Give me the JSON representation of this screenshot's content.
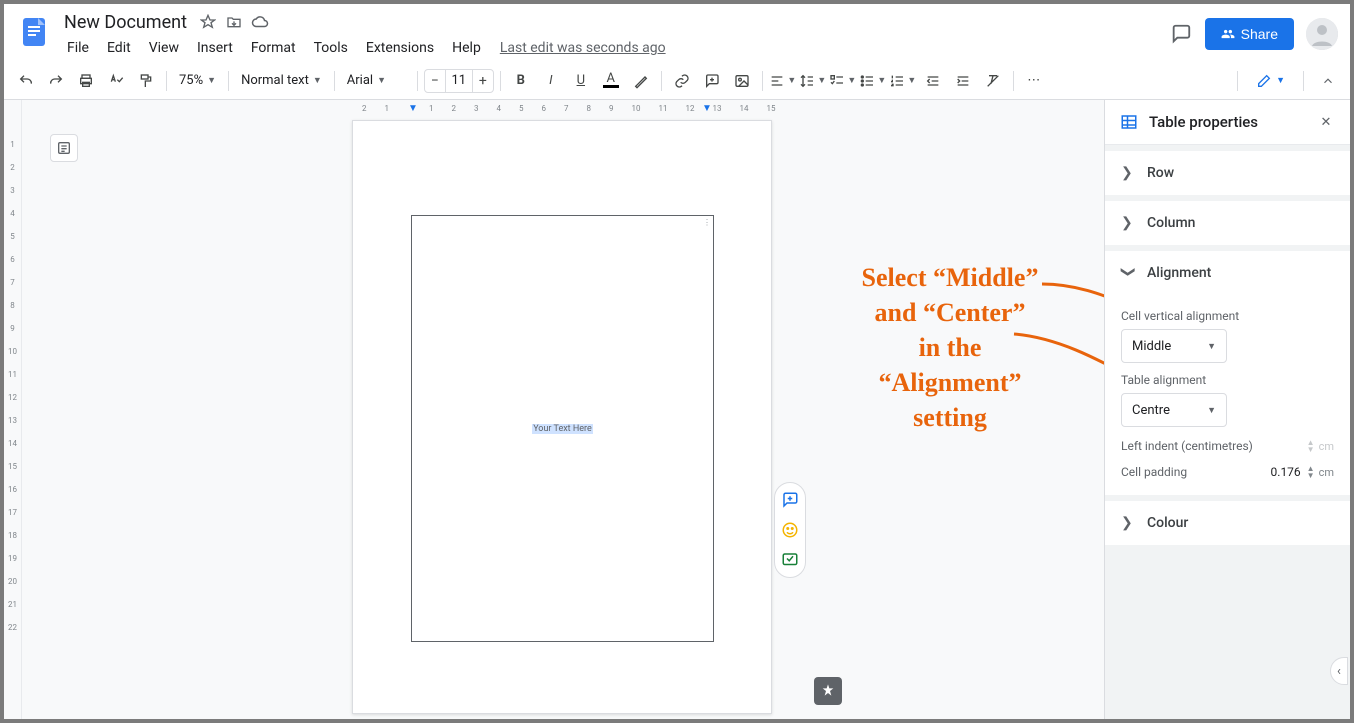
{
  "header": {
    "doc_title": "New Document",
    "menus": [
      "File",
      "Edit",
      "View",
      "Insert",
      "Format",
      "Tools",
      "Extensions",
      "Help"
    ],
    "last_edit": "Last edit was seconds ago",
    "share_label": "Share"
  },
  "toolbar": {
    "zoom": "75%",
    "style": "Normal text",
    "font": "Arial",
    "font_size": "11"
  },
  "hruler": [
    "2",
    "1",
    "1",
    "2",
    "3",
    "4",
    "5",
    "6",
    "7",
    "8",
    "9",
    "10",
    "11",
    "12",
    "13",
    "14",
    "15"
  ],
  "vruler": [
    "1",
    "2",
    "3",
    "4",
    "5",
    "6",
    "7",
    "8",
    "9",
    "10",
    "11",
    "12",
    "13",
    "14",
    "15",
    "16",
    "17",
    "18",
    "19",
    "20",
    "21",
    "22"
  ],
  "document": {
    "placeholder_text": "Your Text Here"
  },
  "annotation": {
    "line1": "Select “Middle”",
    "line2": "and “Center”",
    "line3": "in the",
    "line4": "“Alignment”",
    "line5": "setting"
  },
  "sidebar": {
    "title": "Table properties",
    "sections": {
      "row": "Row",
      "column": "Column",
      "alignment": "Alignment",
      "colour": "Colour"
    },
    "alignment": {
      "cell_vertical_label": "Cell vertical alignment",
      "cell_vertical_value": "Middle",
      "table_alignment_label": "Table alignment",
      "table_alignment_value": "Centre",
      "left_indent_label": "Left indent (centimetres)",
      "left_indent_value": "",
      "left_indent_unit": "cm",
      "cell_padding_label": "Cell padding",
      "cell_padding_value": "0.176",
      "cell_padding_unit": "cm"
    }
  }
}
